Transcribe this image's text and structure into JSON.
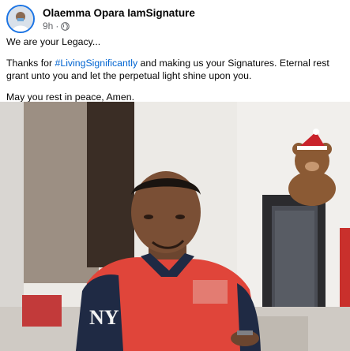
{
  "post": {
    "author": "Olaemma Opara IamSignature",
    "timestamp": "9h",
    "separator": "·",
    "audience_icon": "globe-icon",
    "paragraphs": {
      "p1": "We are your Legacy...",
      "p2_before": "Thanks for ",
      "p2_hashtag": "#LivingSignificantly",
      "p2_after": " and making us your Signatures. Eternal rest grant unto you and let the perpetual light shine upon you.",
      "p3": "May you rest in peace, Amen."
    },
    "photo_shirt_text": "NY",
    "colors": {
      "hashtag": "#0064d1",
      "meta": "#65676b",
      "shirt": "#e0453a",
      "shirt_collar": "#1f2a44"
    }
  }
}
